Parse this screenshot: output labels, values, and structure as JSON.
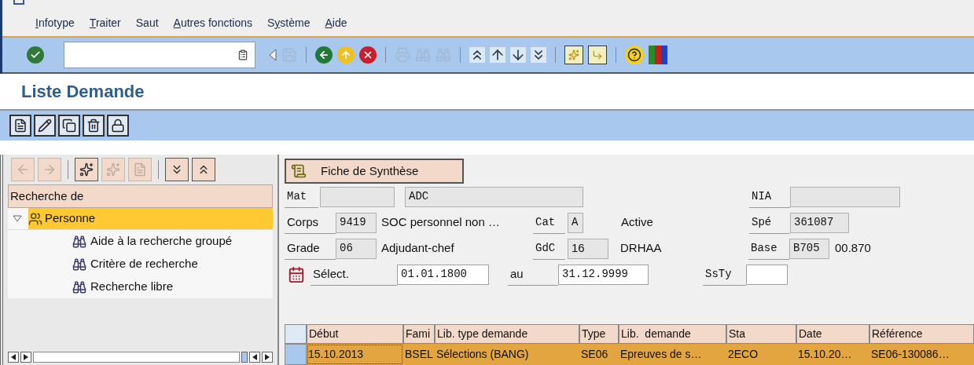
{
  "menu": [
    {
      "mnemonic": "I",
      "after": "nfotype"
    },
    {
      "mnemonic": "T",
      "after": "raiter"
    },
    {
      "before": "Saut"
    },
    {
      "mnemonic": "A",
      "after": "utres fonctions"
    },
    {
      "before": "S",
      "mnemonic": "y",
      "after": "stème"
    },
    {
      "mnemonic": "A",
      "after": "ide"
    }
  ],
  "toolbar": [
    {
      "kind": "enter",
      "disabled": false
    },
    {
      "kind": "command-field"
    },
    {
      "kind": "back-triangle",
      "disabled": false
    },
    {
      "kind": "save",
      "disabled": true
    },
    {
      "kind": "separator"
    },
    {
      "kind": "back",
      "disabled": false
    },
    {
      "kind": "exit",
      "disabled": false
    },
    {
      "kind": "cancel",
      "disabled": false
    },
    {
      "kind": "separator"
    },
    {
      "kind": "print",
      "disabled": true
    },
    {
      "kind": "find",
      "disabled": true
    },
    {
      "kind": "find-next",
      "disabled": true
    },
    {
      "kind": "separator"
    },
    {
      "kind": "first-page",
      "disabled": false
    },
    {
      "kind": "previous-page",
      "disabled": false
    },
    {
      "kind": "next-page",
      "disabled": false
    },
    {
      "kind": "last-page",
      "disabled": false
    },
    {
      "kind": "separator"
    },
    {
      "kind": "new-session",
      "disabled": false
    },
    {
      "kind": "shortcut",
      "disabled": false
    },
    {
      "kind": "separator"
    },
    {
      "kind": "help",
      "disabled": false
    },
    {
      "kind": "layout",
      "disabled": false
    }
  ],
  "title": "Liste Demande",
  "app_toolbar": [
    {
      "kind": "create"
    },
    {
      "kind": "change"
    },
    {
      "kind": "copy"
    },
    {
      "kind": "delete"
    },
    {
      "kind": "lock"
    }
  ],
  "tree_panel": {
    "toolbar": [
      {
        "kind": "back",
        "disabled": true
      },
      {
        "kind": "forward",
        "disabled": true
      },
      {
        "kind": "separator"
      },
      {
        "kind": "new",
        "disabled": false
      },
      {
        "kind": "new-plain",
        "disabled": true
      },
      {
        "kind": "new-doc",
        "disabled": true
      },
      {
        "kind": "separator"
      },
      {
        "kind": "expand",
        "disabled": false
      },
      {
        "kind": "collapse",
        "disabled": false
      }
    ],
    "header": "Recherche de",
    "nodes": [
      {
        "label": "Personne",
        "expanded": true,
        "selected": true,
        "children": [
          {
            "label": "Aide à la recherche groupé",
            "selected": false
          },
          {
            "label": "Critère de recherche",
            "selected": false
          },
          {
            "label": "Recherche libre",
            "selected": false
          }
        ]
      }
    ]
  },
  "form": {
    "button": "Fiche de Synthèse",
    "mat": {
      "label": "Mat",
      "text": "ADC"
    },
    "nia": {
      "label": "NIA"
    },
    "corps": {
      "label": "Corps",
      "code": "9419",
      "text": "SOC personnel non …"
    },
    "cat": {
      "label": "Cat",
      "value": "A"
    },
    "status": "Active",
    "spe": {
      "label": "Spé",
      "value": "361087"
    },
    "grade": {
      "label": "Grade",
      "code": "06",
      "text": "Adjudant-chef"
    },
    "gdc": {
      "label": "GdC",
      "value": "16"
    },
    "org": "DRHAA",
    "base": {
      "label": "Base",
      "value": "B705",
      "text": "00.870"
    },
    "select": {
      "label": "Sélect.",
      "from": "01.01.1800",
      "to_label": "au",
      "to": "31.12.9999"
    },
    "ssty": {
      "label": "SsTy"
    }
  },
  "table": {
    "columns": [
      "Début",
      "Fami",
      "Lib. type demande",
      "Type",
      "Lib.  demande",
      "Sta",
      "Date",
      "Référence"
    ],
    "rows": [
      {
        "selected": true,
        "cells": [
          {
            "text": "15.10.2013",
            "focused": true
          },
          {
            "text": "BSEL",
            "focused": false
          },
          {
            "text": "Sélections (BANG)",
            "focused": false
          },
          {
            "text": "SE06",
            "focused": false
          },
          {
            "text": "Epreuves de s…",
            "focused": false
          },
          {
            "text": "2ECO",
            "focused": false
          },
          {
            "text": "15.10.20…",
            "focused": false
          },
          {
            "text": "SE06-130086…",
            "focused": false
          }
        ]
      }
    ]
  }
}
